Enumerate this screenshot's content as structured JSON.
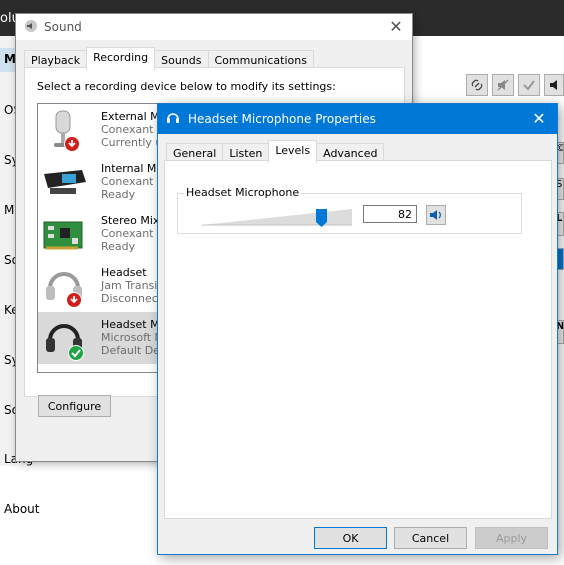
{
  "background": {
    "header_fragment": "olu",
    "nav_fragments": [
      "M",
      "OS",
      "Sy",
      "Mo",
      "So",
      "Ke",
      "Sy",
      "So",
      "Lang"
    ],
    "about": "About",
    "right_fragments": [
      "©",
      "Sy",
      "Li",
      "N"
    ]
  },
  "sound": {
    "title": "Sound",
    "tabs": [
      "Playback",
      "Recording",
      "Sounds",
      "Communications"
    ],
    "instruction": "Select a recording device below to modify its settings:",
    "devices": [
      {
        "name": "External M",
        "line2": "Conexant I",
        "line3": "Currently u"
      },
      {
        "name": "Internal Mi",
        "line2": "Conexant I",
        "line3": "Ready"
      },
      {
        "name": "Stereo Mix",
        "line2": "Conexant I",
        "line3": "Ready"
      },
      {
        "name": "Headset",
        "line2": "Jam Transit",
        "line3": "Disconnect"
      },
      {
        "name": "Headset M",
        "line2": "Microsoft M",
        "line3": "Default De"
      }
    ],
    "configure": "Configure"
  },
  "props": {
    "title": "Headset Microphone Properties",
    "tabs": [
      "General",
      "Listen",
      "Levels",
      "Advanced"
    ],
    "group_label": "Headset Microphone",
    "level": 82,
    "level_text": "82",
    "ok": "OK",
    "cancel": "Cancel",
    "apply": "Apply"
  },
  "colors": {
    "accent": "#0078d7",
    "selection": "#d9d9d9",
    "ok_green": "#1ea347",
    "error_red": "#d0201c"
  }
}
